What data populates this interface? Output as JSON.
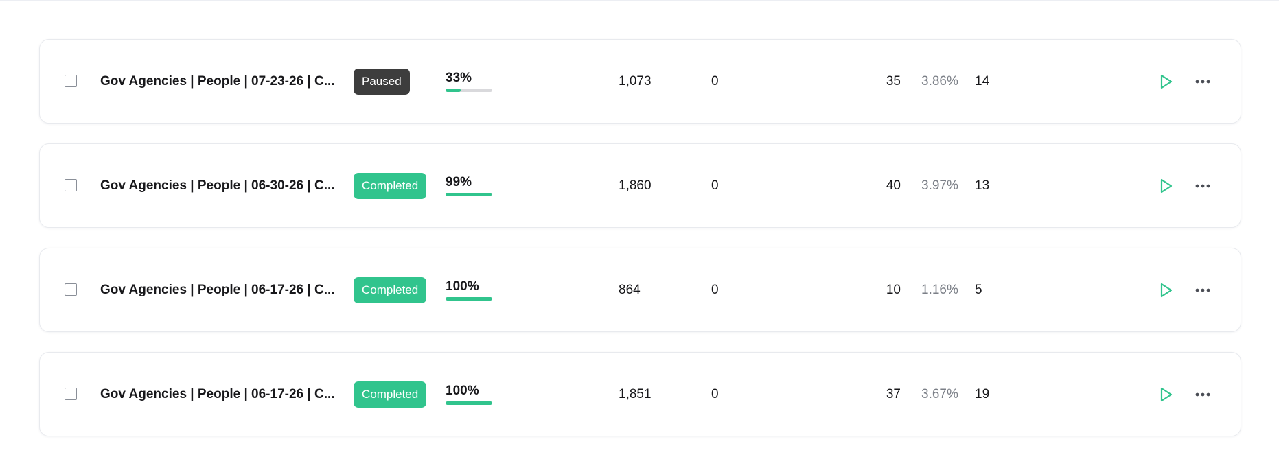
{
  "colors": {
    "paused_badge": "#3d3d3d",
    "completed_badge": "#31c48d",
    "progress_fill": "#31c48d",
    "progress_track": "#d9d9dc",
    "play_icon": "#31c48d",
    "rate_text": "#7b7f87"
  },
  "campaigns": [
    {
      "name": "Gov Agencies | People | 07-23-26 | C...",
      "status": "Paused",
      "status_type": "paused",
      "progress_label": "33%",
      "progress": 0.33,
      "sent": "1,073",
      "zero": "0",
      "opens": "35",
      "rate": "3.86%",
      "replies": "14",
      "play_icon": "play-icon",
      "more_icon": "more-horizontal-icon"
    },
    {
      "name": "Gov Agencies | People | 06-30-26 | C...",
      "status": "Completed",
      "status_type": "completed",
      "progress_label": "99%",
      "progress": 0.99,
      "sent": "1,860",
      "zero": "0",
      "opens": "40",
      "rate": "3.97%",
      "replies": "13",
      "play_icon": "play-icon",
      "more_icon": "more-horizontal-icon"
    },
    {
      "name": "Gov Agencies | People | 06-17-26 | C...",
      "status": "Completed",
      "status_type": "completed",
      "progress_label": "100%",
      "progress": 1.0,
      "sent": "864",
      "zero": "0",
      "opens": "10",
      "rate": "1.16%",
      "replies": "5",
      "play_icon": "play-icon",
      "more_icon": "more-horizontal-icon"
    },
    {
      "name": "Gov Agencies | People | 06-17-26 | C...",
      "status": "Completed",
      "status_type": "completed",
      "progress_label": "100%",
      "progress": 1.0,
      "sent": "1,851",
      "zero": "0",
      "opens": "37",
      "rate": "3.67%",
      "replies": "19",
      "play_icon": "play-icon",
      "more_icon": "more-horizontal-icon"
    }
  ]
}
